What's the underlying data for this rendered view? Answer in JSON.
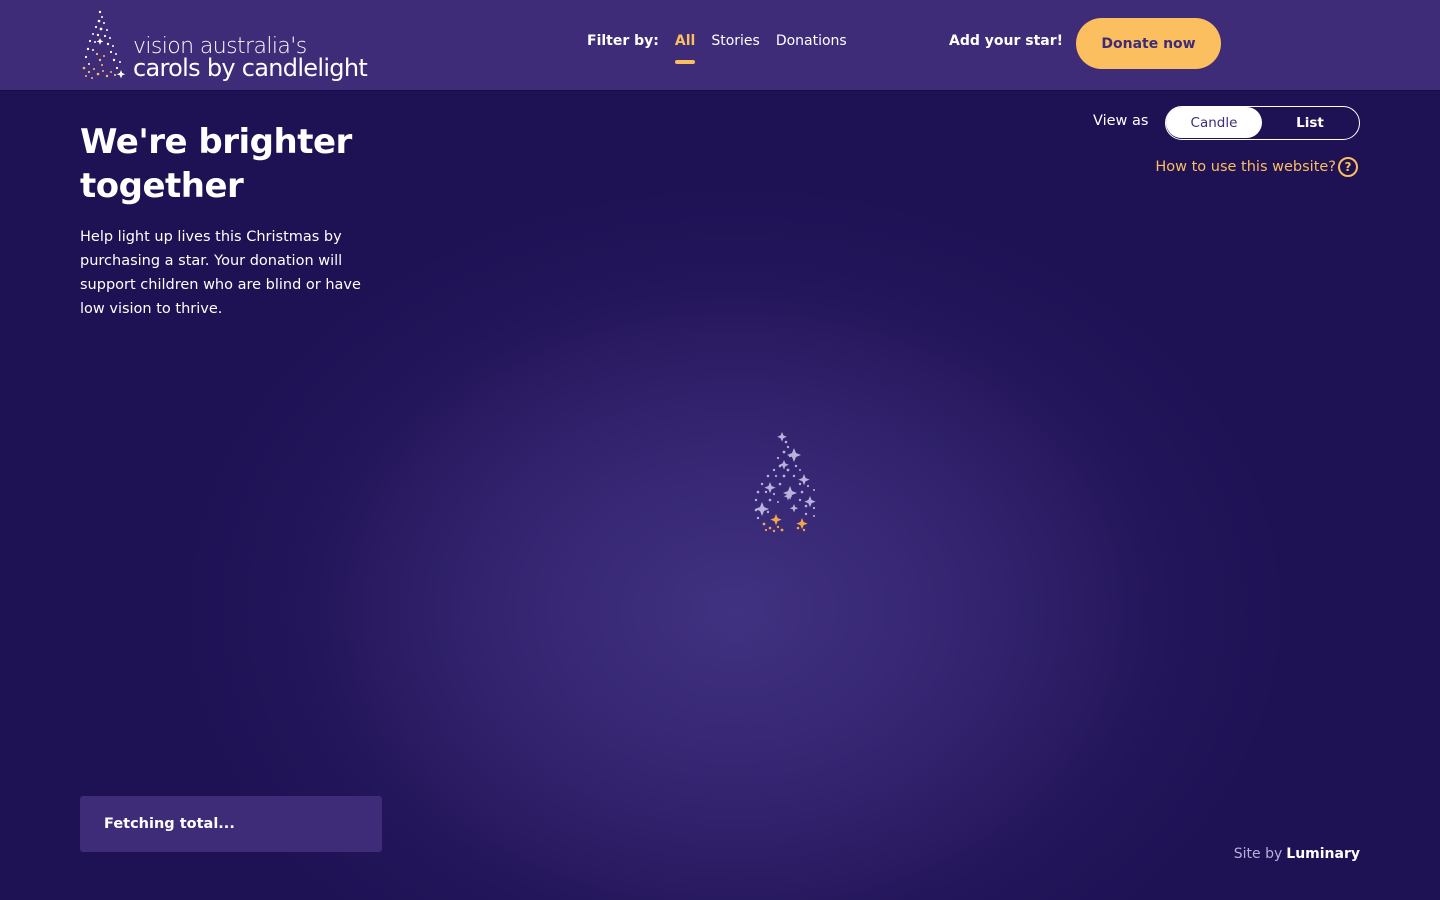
{
  "header": {
    "logo": {
      "line1": "vision australia's",
      "line2": "carols by candlelight",
      "icon": "candle-flame-stars-icon"
    },
    "filter_label": "Filter by:",
    "filters": [
      {
        "label": "All",
        "active": true
      },
      {
        "label": "Stories",
        "active": false
      },
      {
        "label": "Donations",
        "active": false
      }
    ],
    "add_star": "Add your star!",
    "donate": "Donate now"
  },
  "intro": {
    "headline": "We're brighter together",
    "body": "Help light up lives this Christmas by purchasing a star. Your donation will support children who are blind or have low vision to thrive."
  },
  "view": {
    "label": "View as",
    "options": [
      {
        "label": "Candle",
        "active": true
      },
      {
        "label": "List",
        "active": false
      }
    ],
    "help_text": "How to use this website?",
    "help_icon": "question-circle-icon"
  },
  "center": {
    "icon": "loading-flame-icon"
  },
  "footer": {
    "total_text": "Fetching total...",
    "site_by_label": "Site by",
    "site_by_brand": "Luminary"
  },
  "colors": {
    "background": "#1e1154",
    "header": "#3e2c79",
    "accent": "#fbbf5f",
    "text": "#ffffff"
  }
}
